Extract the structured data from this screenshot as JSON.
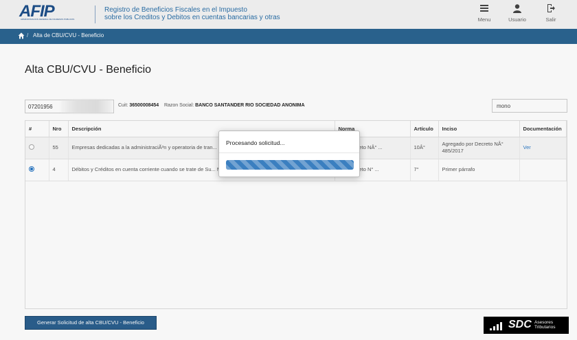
{
  "header": {
    "logo_text": "AFIP",
    "logo_subtext": "ADMINISTRACION FEDERAL DE INGRESOS PUBLICOS",
    "title_line1": "Registro de Beneficios Fiscales en el Impuesto",
    "title_line2": "sobre los Creditos y Debitos en cuentas bancarias y otras",
    "menu_label": "Menu",
    "user_label": "Usuario",
    "exit_label": "Salir"
  },
  "breadcrumb": {
    "separator": "/",
    "current": "Alta de CBU/CVU - Beneficio"
  },
  "page": {
    "title": "Alta CBU/CVU - Beneficio"
  },
  "filters": {
    "cbu_value": "07201956",
    "cuit_label": "Cuit:",
    "cuit_value": "36500008454",
    "razon_label": "Razon Social:",
    "razon_value": "BANCO SANTANDER RIO SOCIEDAD ANONIMA",
    "search_value": "mono"
  },
  "table": {
    "headers": [
      "#",
      "Nro",
      "Descripción",
      "Norma",
      "Artículo",
      "Inciso",
      "Documentación"
    ],
    "rows": [
      {
        "selected": false,
        "nro": "55",
        "descripcion": "Empresas dedicadas a la administraciÃ³n y operatoria de tran... mÃ³viles y sus agentes",
        "norma": "...el Decreto NÂ° ...",
        "articulo": "10Â°",
        "inciso": "Agregado por Decreto NÂ° 485/2017",
        "documentacion": "Ver"
      },
      {
        "selected": true,
        "nro": "4",
        "descripcion": "Débitos y Créditos en cuenta corriente cuando se trate de Su... Monotributo.",
        "norma": "...el Decreto N° ...",
        "articulo": "7°",
        "inciso": "Primer párrafo",
        "documentacion": ""
      }
    ]
  },
  "actions": {
    "generate_label": "Generar Solicitud de alta CBU/CVU - Beneficio"
  },
  "modal": {
    "title": "Procesando solicitud...",
    "progress": 1.0
  },
  "watermark": {
    "brand": "SDC",
    "tagline_line1": "Asesores",
    "tagline_line2": "Tributarios"
  },
  "colors": {
    "brand_blue": "#2b6591",
    "button_blue": "#2b5f8e",
    "progress_blue": "#3b7fc0",
    "link_blue": "#2b78c5"
  }
}
